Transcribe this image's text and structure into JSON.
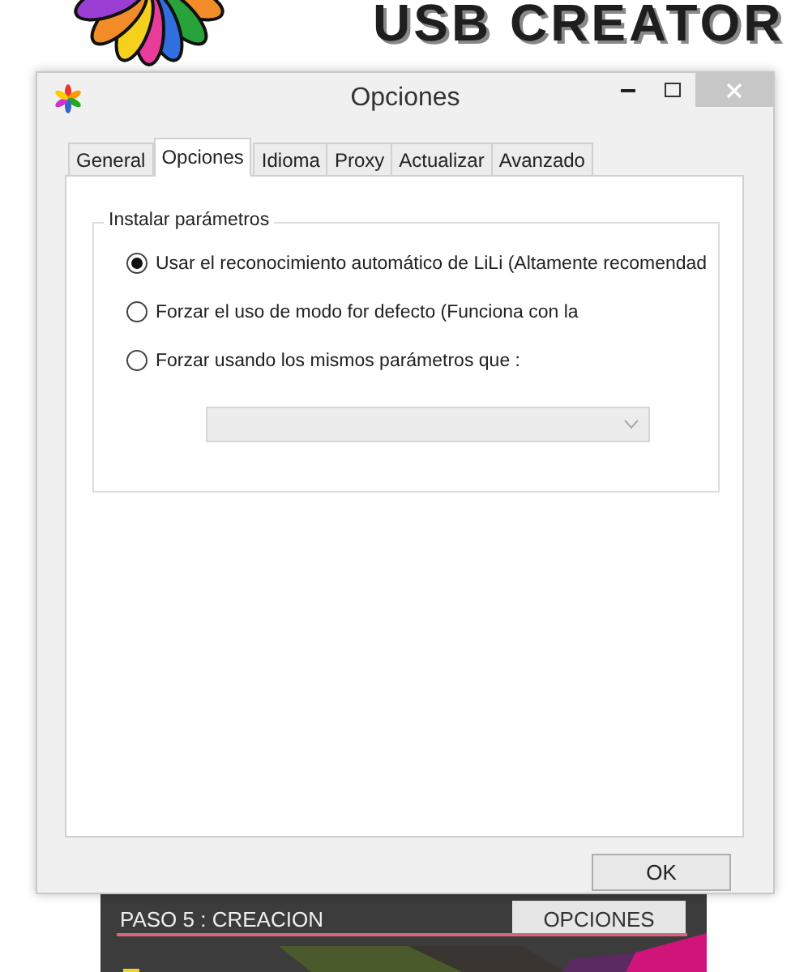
{
  "background": {
    "logo_text": "USB CREATOR",
    "step_label": "PASO 5 : CREACION",
    "options_button": "OPCIONES"
  },
  "dialog": {
    "title": "Opciones",
    "tabs": [
      {
        "label": "General",
        "selected": false
      },
      {
        "label": "Opciones",
        "selected": true
      },
      {
        "label": "Idioma",
        "selected": false
      },
      {
        "label": "Proxy",
        "selected": false
      },
      {
        "label": "Actualizar",
        "selected": false
      },
      {
        "label": "Avanzado",
        "selected": false
      }
    ],
    "group": {
      "title": "Instalar parámetros",
      "options": [
        {
          "label": "Usar el reconocimiento automático de LiLi (Altamente recomendad",
          "selected": true
        },
        {
          "label": "Forzar el uso de modo for defecto (Funciona con la",
          "selected": false
        },
        {
          "label": "Forzar usando los mismos parámetros que :",
          "selected": false
        }
      ],
      "dropdown": {
        "disabled": true
      }
    },
    "ok_button": "OK"
  }
}
